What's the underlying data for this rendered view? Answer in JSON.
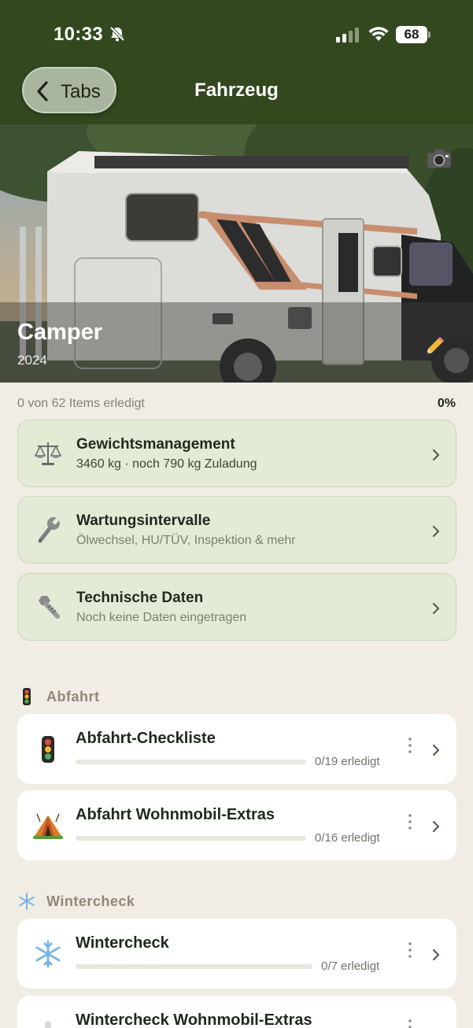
{
  "status_bar": {
    "time": "10:33",
    "battery": "68"
  },
  "nav": {
    "back_label": "Tabs",
    "title": "Fahrzeug"
  },
  "vehicle": {
    "name": "Camper",
    "year": "2024"
  },
  "progress": {
    "text": "0 von 62 Items erledigt",
    "percent": "0%"
  },
  "info_cards": [
    {
      "title": "Gewichtsmanagement",
      "subtitle": "3460 kg · noch 790 kg Zuladung",
      "icon": "scale-icon"
    },
    {
      "title": "Wartungsintervalle",
      "subtitle": "Ölwechsel, HU/TÜV, Inspektion & mehr",
      "icon": "wrench-icon"
    },
    {
      "title": "Technische Daten",
      "subtitle": "Noch keine Daten eingetragen",
      "icon": "nut-bolt-icon"
    }
  ],
  "sections": [
    {
      "title": "Abfahrt",
      "icon": "traffic-light-icon",
      "items": [
        {
          "title": "Abfahrt-Checkliste",
          "count": "0/19 erledigt",
          "progress": 0,
          "icon": "traffic-light-icon"
        },
        {
          "title": "Abfahrt Wohnmobil-Extras",
          "count": "0/16 erledigt",
          "progress": 0,
          "icon": "tent-icon"
        }
      ]
    },
    {
      "title": "Wintercheck",
      "icon": "snowflake-icon",
      "items": [
        {
          "title": "Wintercheck",
          "count": "0/7 erledigt",
          "progress": 0,
          "icon": "snowflake-icon"
        },
        {
          "title": "Wintercheck Wohnmobil-Extras",
          "icon": "thermometer-icon"
        }
      ]
    }
  ],
  "colors": {
    "header": "#33481f",
    "background": "#f1ede4",
    "info_card": "#e3ead5",
    "list_card": "#ffffff"
  }
}
